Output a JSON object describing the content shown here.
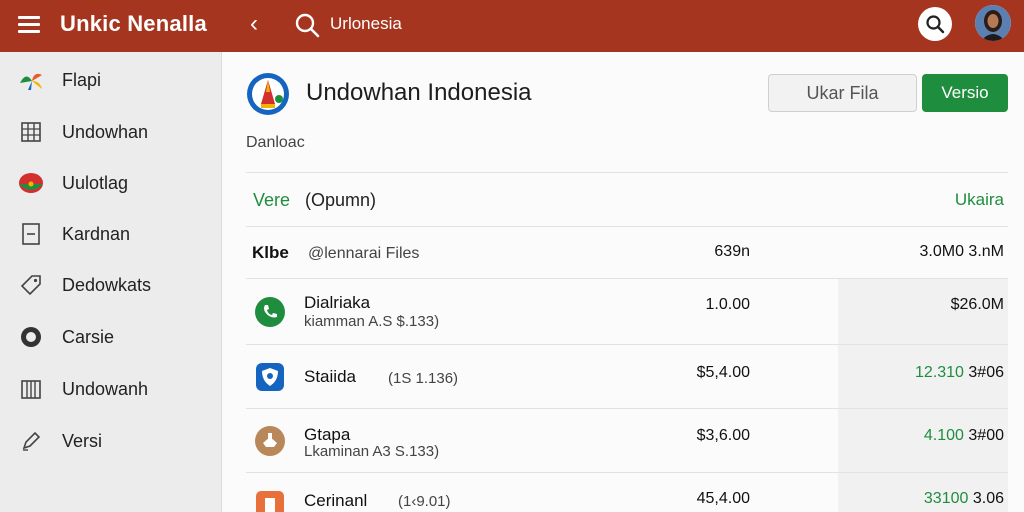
{
  "header": {
    "app_title": "Unkic Nenalla",
    "search_text": "Urlonesia"
  },
  "sidebar": {
    "items": [
      {
        "label": "Flapi",
        "icon": "colorful-fan-icon"
      },
      {
        "label": "Undowhan",
        "icon": "grid-list-icon"
      },
      {
        "label": "Uulotlag",
        "icon": "indonesia-flag-icon"
      },
      {
        "label": "Kardnan",
        "icon": "document-icon"
      },
      {
        "label": "Dedowkats",
        "icon": "tag-icon"
      },
      {
        "label": "Carsie",
        "icon": "circle-icon"
      },
      {
        "label": "Undowanh",
        "icon": "building-icon"
      },
      {
        "label": "Versi",
        "icon": "pencil-icon"
      }
    ]
  },
  "main": {
    "title": "Undowhan Indonesia",
    "secondary_button": "Ukar Fila",
    "primary_button": "Versio",
    "subtitle": "Danloac"
  },
  "table": {
    "header": {
      "left": "Vere",
      "mid": "(Opumn)",
      "right": "Ukaira"
    },
    "subheader": {
      "a": "Klbe",
      "b": "@lennarai Files",
      "c": "639n",
      "d": "3.0M0 3.nM"
    },
    "rows": [
      {
        "name": "Dialriaka",
        "detail": "kiamman A.S $.133)",
        "amount": "1.0.00",
        "right_green": "",
        "right": "$26.0M",
        "icon": "phone-icon",
        "color": "#1e8e3e"
      },
      {
        "name": "Staiida",
        "detail": "(1S 1.136)",
        "amount": "$5,4.00",
        "right_green": "12.310",
        "right": "3#06",
        "icon": "shield-icon",
        "color": "#1565c0"
      },
      {
        "name": "Gtapa",
        "detail": "Lkaminan A3 S.133)",
        "amount": "$3,6.00",
        "right_green": "4.100",
        "right": "3#00",
        "icon": "hand-icon",
        "color": "#b8875a"
      },
      {
        "name": "Cerinanl",
        "detail": "(1‹9.01)",
        "amount": "45,4.00",
        "right_green": "33100",
        "right": "3.06",
        "icon": "orange-app-icon",
        "color": "#e8703a"
      }
    ]
  }
}
